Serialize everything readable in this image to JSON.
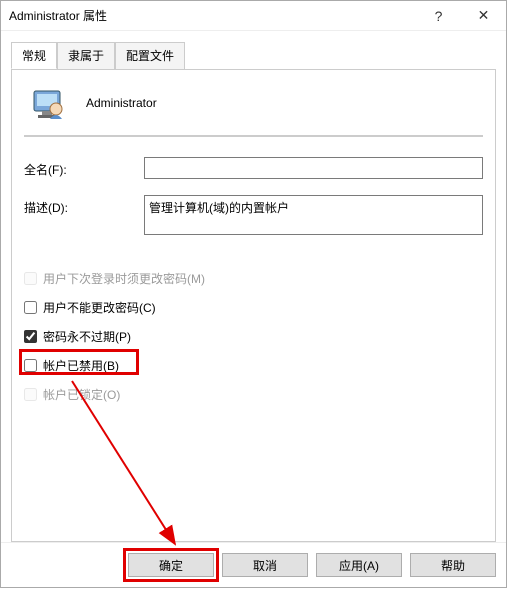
{
  "title": "Administrator 属性",
  "help_char": "?",
  "close_char": "✕",
  "tabs": {
    "general": "常规",
    "memberof": "隶属于",
    "profile": "配置文件"
  },
  "header_name": "Administrator",
  "fields": {
    "fullname_label": "全名(F):",
    "fullname_value": "",
    "desc_label": "描述(D):",
    "desc_value": "管理计算机(域)的内置帐户"
  },
  "checks": {
    "mustchange": "用户下次登录时须更改密码(M)",
    "cannotchange": "用户不能更改密码(C)",
    "neverexpire": "密码永不过期(P)",
    "disabled": "帐户已禁用(B)",
    "locked": "帐户已锁定(O)"
  },
  "buttons": {
    "ok": "确定",
    "cancel": "取消",
    "apply": "应用(A)",
    "help": "帮助"
  }
}
